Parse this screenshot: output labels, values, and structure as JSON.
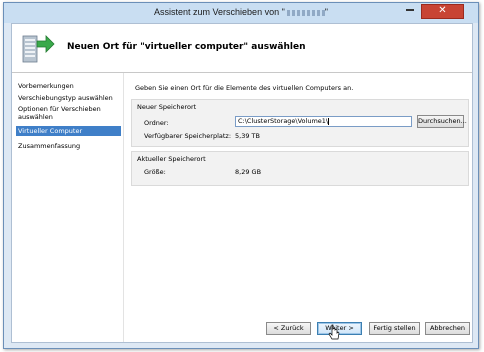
{
  "window": {
    "title_prefix": "Assistent zum Verschieben von \"",
    "title_suffix": "\"",
    "close_glyph": "✕"
  },
  "header": {
    "title": "Neuen Ort für \"virtueller computer\" auswählen"
  },
  "nav": {
    "items": [
      {
        "label": "Vorbemerkungen",
        "active": false
      },
      {
        "label": "Verschiebungstyp auswählen",
        "active": false
      },
      {
        "label": "Optionen für Verschieben auswählen",
        "active": false
      },
      {
        "label": "Virtueller Computer",
        "active": true
      },
      {
        "label": "Zusammenfassung",
        "active": false
      }
    ]
  },
  "main": {
    "intro": "Geben Sie einen Ort für die Elemente des virtuellen Computers an.",
    "new_location": {
      "title": "Neuer Speicherort",
      "folder_label": "Ordner:",
      "folder_value": "C:\\ClusterStorage\\Volume1\\",
      "browse_label": "Durchsuchen...",
      "free_space_label": "Verfügbarer Speicherplatz:",
      "free_space_value": "5,39 TB"
    },
    "current_location": {
      "title": "Aktueller Speicherort",
      "size_label": "Größe:",
      "size_value": "8,29 GB"
    }
  },
  "footer": {
    "back_label": "< Zurück",
    "next_label": "Weiter >",
    "finish_label": "Fertig stellen",
    "cancel_label": "Abbrechen"
  },
  "colors": {
    "active_nav": "#3f7fc8",
    "close_button": "#c84434",
    "titlebar": "#c9def2"
  }
}
